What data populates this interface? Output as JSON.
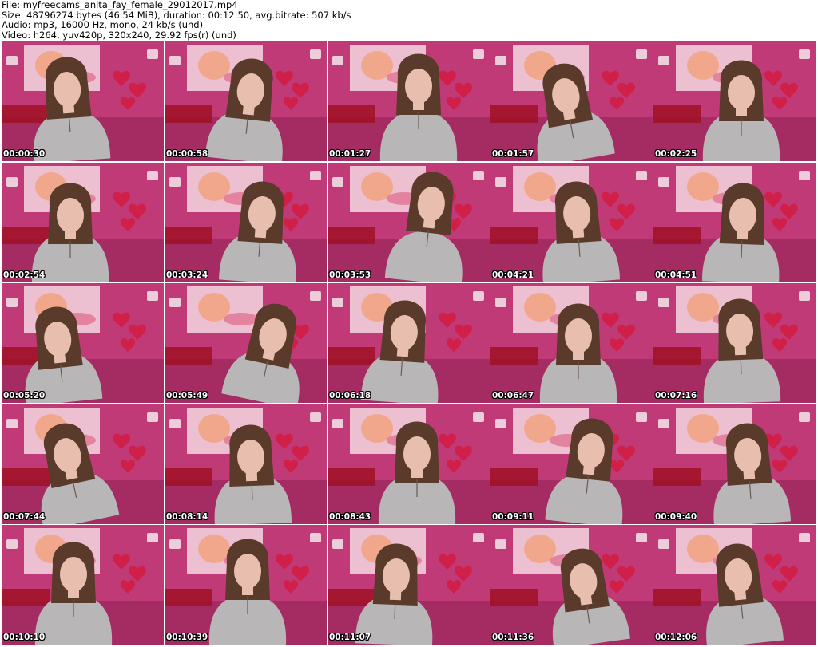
{
  "header": {
    "file": "File: myfreecams_anita_fay_female_29012017.mp4",
    "size": "Size: 48796274 bytes (46.54 MiB), duration: 00:12:50, avg.bitrate: 507 kb/s",
    "audio": "Audio: mp3, 16000 Hz, mono, 24 kb/s (und)",
    "video": "Video: h264, yuv420p, 320x240, 29.92 fps(r) (und)"
  },
  "colors": {
    "wall": "#c03a78",
    "wall_dark": "#8e1f52",
    "poster": "#f1cfd9",
    "sweater": "#b8b6b6",
    "hair": "#5a3a2a",
    "skin": "#e8bfae",
    "timestamp": "#ffffff"
  },
  "thumbnails": [
    {
      "time": "00:00:30"
    },
    {
      "time": "00:00:58"
    },
    {
      "time": "00:01:27"
    },
    {
      "time": "00:01:57"
    },
    {
      "time": "00:02:25"
    },
    {
      "time": "00:02:54"
    },
    {
      "time": "00:03:24"
    },
    {
      "time": "00:03:53"
    },
    {
      "time": "00:04:21"
    },
    {
      "time": "00:04:51"
    },
    {
      "time": "00:05:20"
    },
    {
      "time": "00:05:49"
    },
    {
      "time": "00:06:18"
    },
    {
      "time": "00:06:47"
    },
    {
      "time": "00:07:16"
    },
    {
      "time": "00:07:44"
    },
    {
      "time": "00:08:14"
    },
    {
      "time": "00:08:43"
    },
    {
      "time": "00:09:11"
    },
    {
      "time": "00:09:40"
    },
    {
      "time": "00:10:10"
    },
    {
      "time": "00:10:39"
    },
    {
      "time": "00:11:07"
    },
    {
      "time": "00:11:36"
    },
    {
      "time": "00:12:06"
    }
  ]
}
